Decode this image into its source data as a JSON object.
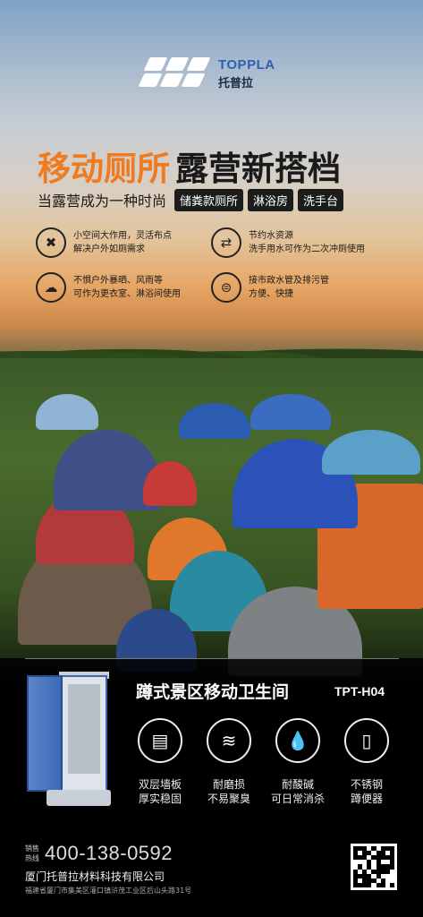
{
  "brand": {
    "name_en": "TOPPLA",
    "name_cn": "托普拉",
    "colors": {
      "accent": "#ef7b1e",
      "brand_blue": "#2f5fb0"
    }
  },
  "hero": {
    "headline_orange": "移动厕所",
    "headline_dark": "露营新搭档",
    "subline": "当露营成为一种时尚",
    "tags": [
      "储粪款厕所",
      "淋浴房",
      "洗手台"
    ]
  },
  "features": [
    {
      "icon": "tools-icon",
      "line1": "小空间大作用，灵活布点",
      "line2": "解决户外如厕需求"
    },
    {
      "icon": "recycle-icon",
      "line1": "节约水资源",
      "line2": "洗手用水可作为二次冲厕使用"
    },
    {
      "icon": "weather-icon",
      "line1": "不惧户外暴晒、风雨等",
      "line2": "可作为更衣室、淋浴间使用"
    },
    {
      "icon": "pipe-icon",
      "line1": "接市政水管及排污管",
      "line2": "方便、快捷"
    }
  ],
  "product": {
    "title": "蹲式景区移动卫生间",
    "model": "TPT-H04",
    "features": [
      {
        "icon": "wall-panel-icon",
        "line1": "双层墙板",
        "line2": "厚实稳固"
      },
      {
        "icon": "wear-resistant-icon",
        "line1": "耐磨损",
        "line2": "不易聚臭"
      },
      {
        "icon": "acid-alkali-icon",
        "line1": "耐酸碱",
        "line2": "可日常消杀"
      },
      {
        "icon": "steel-squat-icon",
        "line1": "不锈钢",
        "line2": "蹲便器"
      }
    ]
  },
  "contact": {
    "hotline_label": "销售热线",
    "phone": "400-138-0592",
    "company": "厦门托普拉材料科技有限公司",
    "address": "福建省厦门市集美区灌口镇浒茂工业区后山头路31号"
  }
}
